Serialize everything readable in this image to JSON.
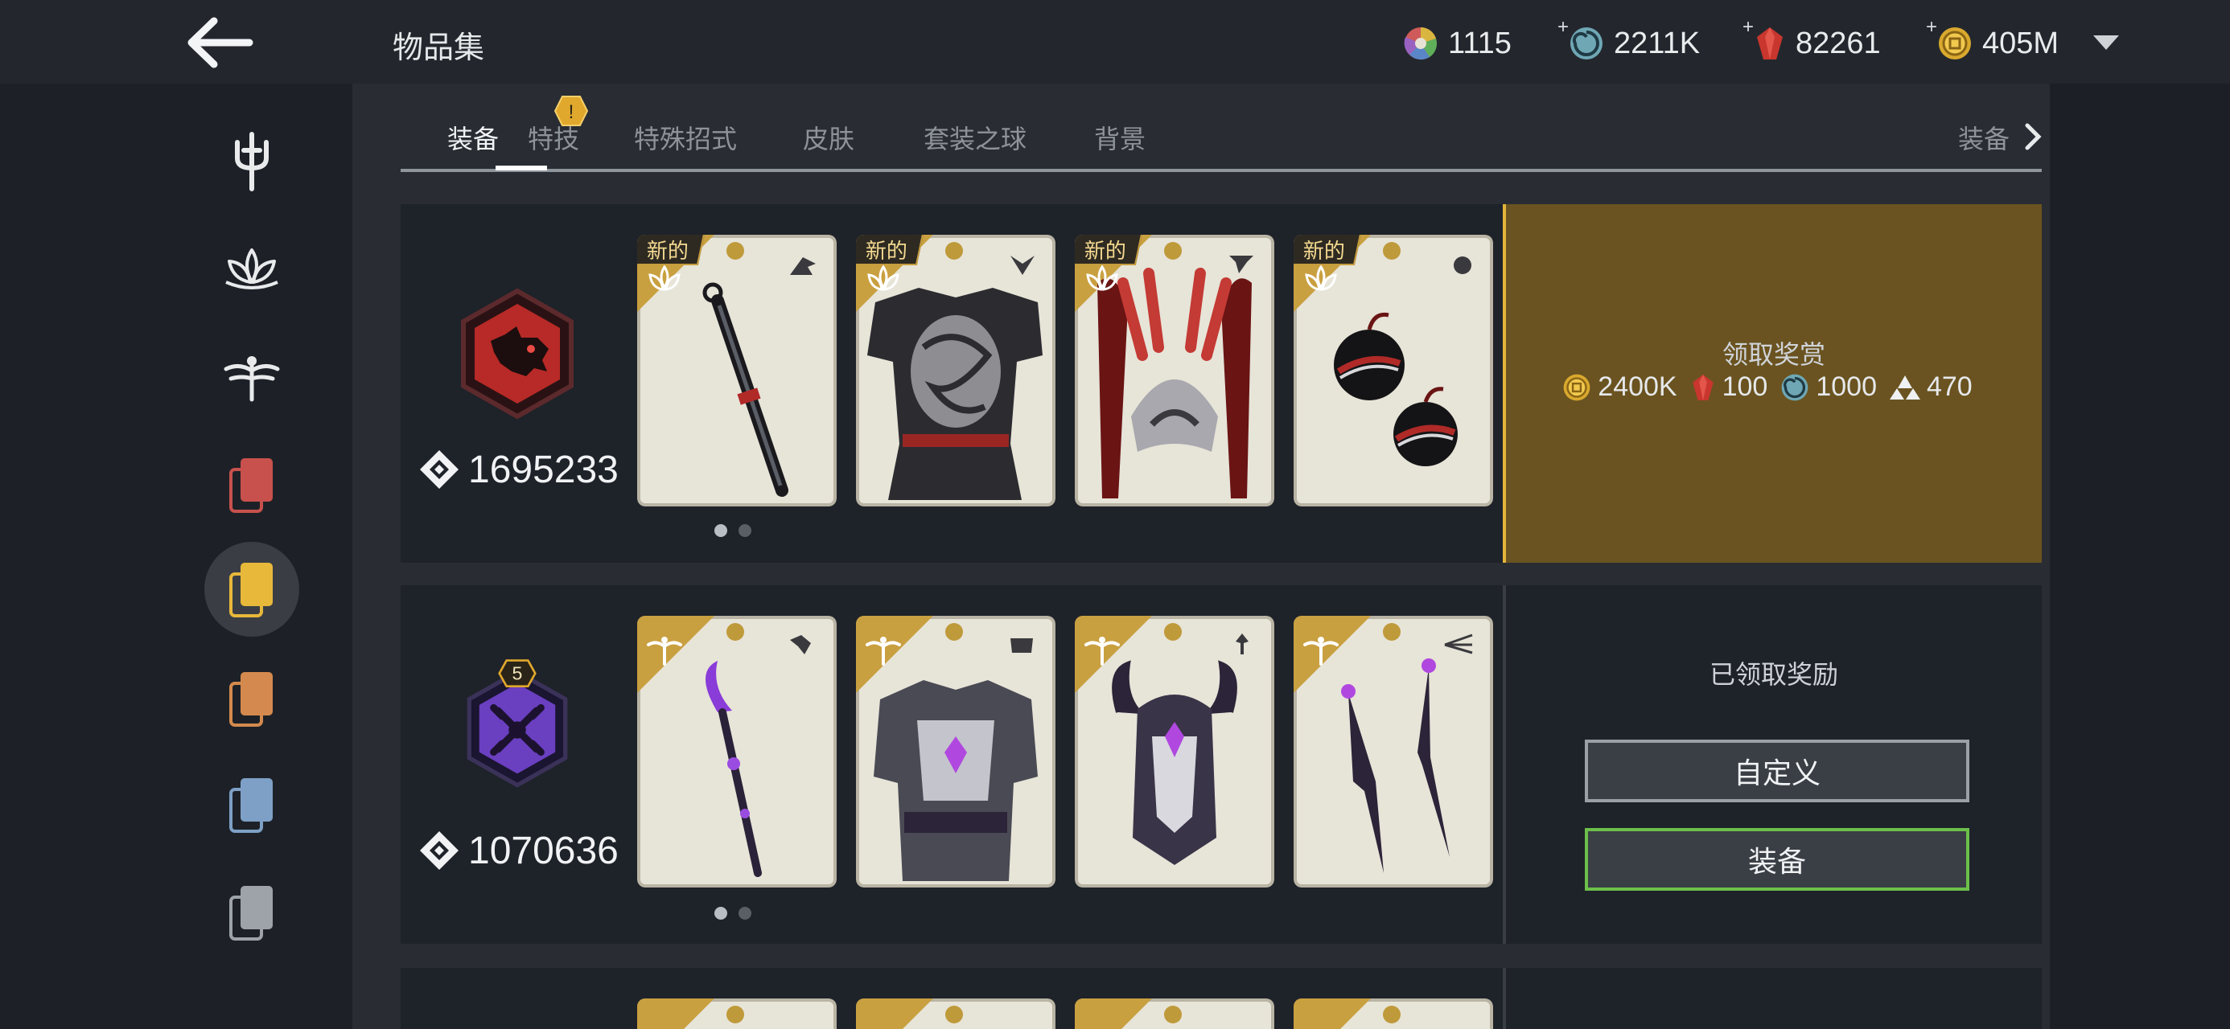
{
  "header": {
    "title": "物品集",
    "currencies": [
      {
        "icon": "color-wheel-icon",
        "value": "1115"
      },
      {
        "icon": "spiral-orb-icon",
        "value": "2211K"
      },
      {
        "icon": "red-gem-icon",
        "value": "82261"
      },
      {
        "icon": "gold-coin-icon",
        "value": "405M"
      }
    ]
  },
  "tabs": {
    "items": [
      "装备",
      "特技",
      "特殊招式",
      "皮肤",
      "套装之球",
      "背景"
    ],
    "badge": "!",
    "overflow_label": "装备"
  },
  "sets": [
    {
      "power": "1695233",
      "emblem": "red-boar-emblem",
      "new_tag": "新的",
      "items": [
        "weapon-staff",
        "chest-armor",
        "helmet",
        "bombs"
      ],
      "reward": {
        "title": "领取奖赏",
        "items": [
          {
            "icon": "gold-coin-icon",
            "value": "2400K"
          },
          {
            "icon": "red-gem-icon",
            "value": "100"
          },
          {
            "icon": "spiral-orb-icon",
            "value": "1000"
          },
          {
            "icon": "triangle-shards-icon",
            "value": "470"
          }
        ]
      }
    },
    {
      "power": "1070636",
      "emblem": "purple-crossed-emblem",
      "emblem_level": "5",
      "items": [
        "weapon-spear",
        "chest-armor",
        "helmet",
        "kunai"
      ],
      "claimed_text": "已领取奖励",
      "customize_label": "自定义",
      "equip_label": "装备"
    }
  ],
  "colors": {
    "accent_gold": "#e3b43a",
    "reward_bg": "#6a5320",
    "equip_border": "#6cc04a"
  }
}
